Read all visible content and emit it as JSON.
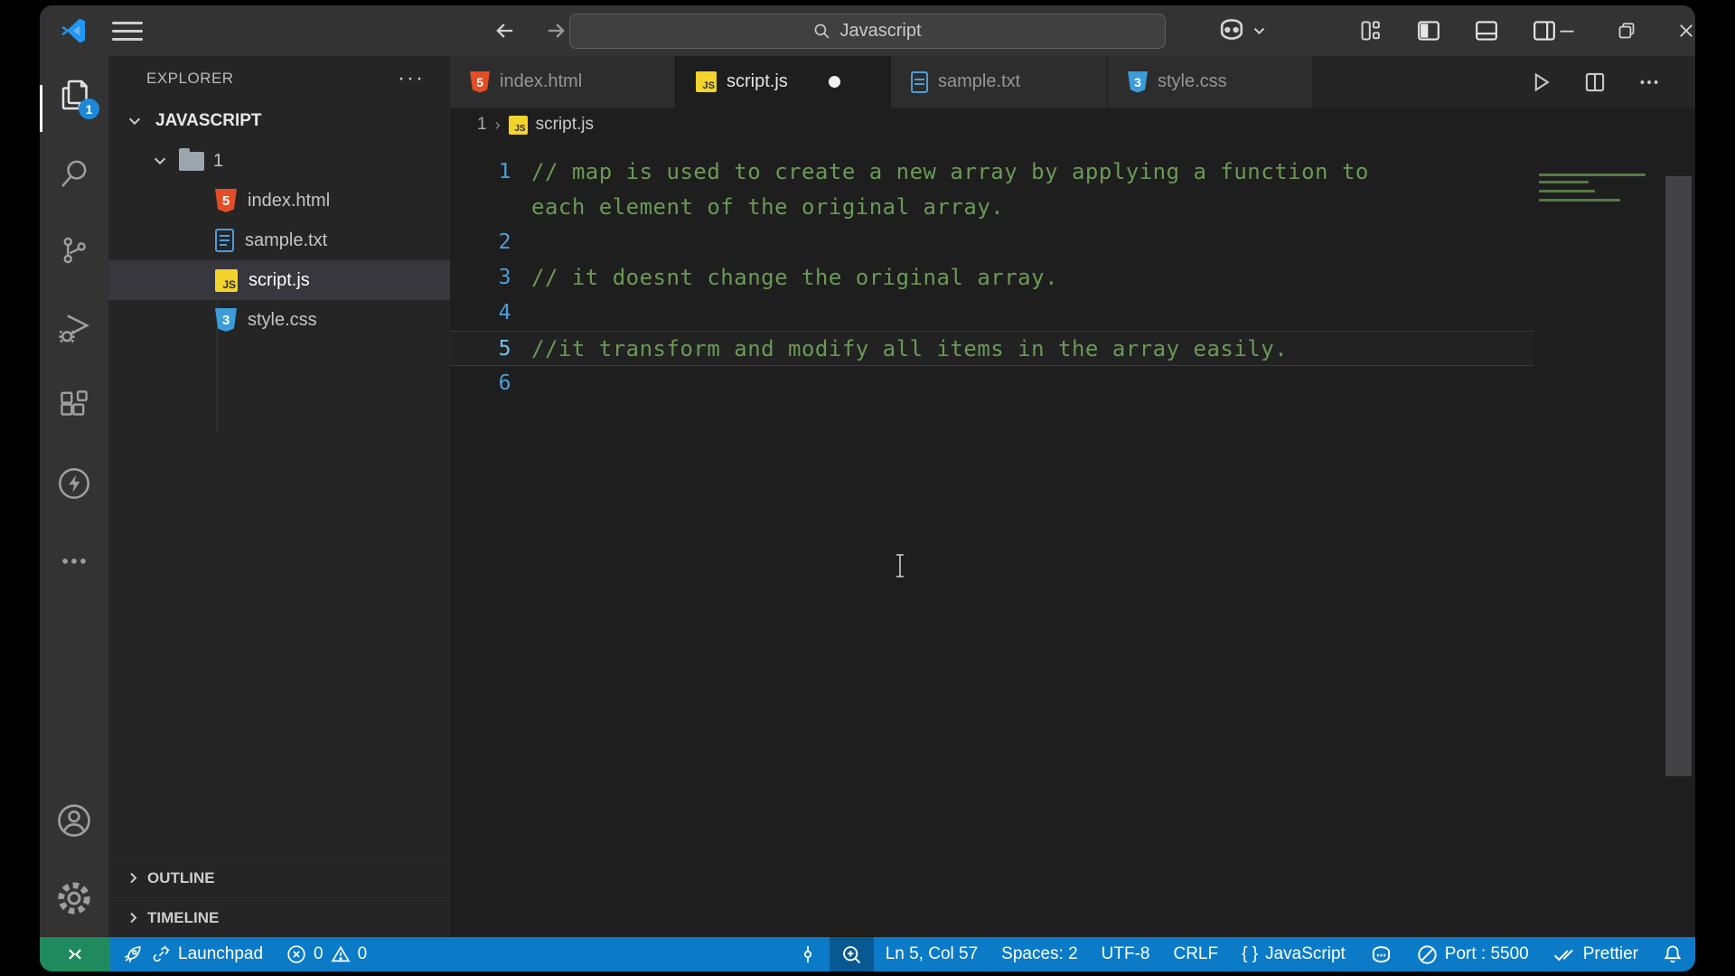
{
  "titlebar": {
    "search_value": "Javascript",
    "icons": [
      "vscode-logo",
      "menu-icon",
      "arrow-left-icon",
      "arrow-right-icon",
      "search-icon",
      "copilot-icon",
      "chevron-down-icon",
      "customize-layout-icon",
      "toggle-sidebar-icon",
      "toggle-panel-icon",
      "toggle-secondary-sidebar-icon",
      "minimize-icon",
      "restore-icon",
      "close-icon"
    ]
  },
  "activity_bar": {
    "badge": "1",
    "items": [
      "explorer-files-icon",
      "search-icon",
      "source-control-icon",
      "run-debug-icon",
      "extensions-icon",
      "thunder-icon",
      "more-icon",
      "account-icon",
      "settings-gear-icon"
    ]
  },
  "explorer": {
    "title": "EXPLORER",
    "actions_label": "···",
    "root": "JAVASCRIPT",
    "folder": "1",
    "files": [
      {
        "name": "index.html",
        "icon": "html-icon",
        "selected": false
      },
      {
        "name": "sample.txt",
        "icon": "txt-icon",
        "selected": false
      },
      {
        "name": "script.js",
        "icon": "js-icon",
        "selected": true
      },
      {
        "name": "style.css",
        "icon": "css-icon",
        "selected": false
      }
    ],
    "sections": [
      {
        "label": "OUTLINE"
      },
      {
        "label": "TIMELINE"
      }
    ]
  },
  "tabs": [
    {
      "label": "index.html",
      "icon": "html-icon",
      "active": false,
      "dirty": false
    },
    {
      "label": "script.js",
      "icon": "js-icon",
      "active": true,
      "dirty": true
    },
    {
      "label": "sample.txt",
      "icon": "txt-icon",
      "active": false,
      "dirty": false
    },
    {
      "label": "style.css",
      "icon": "css-icon",
      "active": false,
      "dirty": false
    }
  ],
  "breadcrumb": {
    "folder": "1",
    "file": "script.js"
  },
  "editor": {
    "language": "javascript",
    "rows": [
      {
        "n": "1",
        "t": "// map is used to create a new array by applying a function to"
      },
      {
        "n": "",
        "t": "each element of the original array."
      },
      {
        "n": "2",
        "t": ""
      },
      {
        "n": "3",
        "t": "// it doesnt change the original array."
      },
      {
        "n": "4",
        "t": ""
      },
      {
        "n": "5",
        "t": "//it transform and modify all items in the array easily."
      },
      {
        "n": "6",
        "t": ""
      }
    ],
    "current_line": 5
  },
  "status_bar": {
    "launchpad": "Launchpad",
    "errors": "0",
    "warnings": "0",
    "line_col": "Ln 5, Col 57",
    "spaces": "Spaces: 2",
    "encoding": "UTF-8",
    "eol": "CRLF",
    "braces": "{ }",
    "language": "JavaScript",
    "port": "Port : 5500",
    "formatter": "Prettier"
  },
  "colors": {
    "status_bar": "#0b7bc8",
    "remote_indicator": "#1e8a5e",
    "badge": "#1f87d7",
    "comment_green": "#6a9955",
    "line_number_blue": "#4d9fd9",
    "js_yellow": "#f2d42c",
    "html_orange": "#e44d26",
    "css_blue": "#3b9cd9"
  }
}
